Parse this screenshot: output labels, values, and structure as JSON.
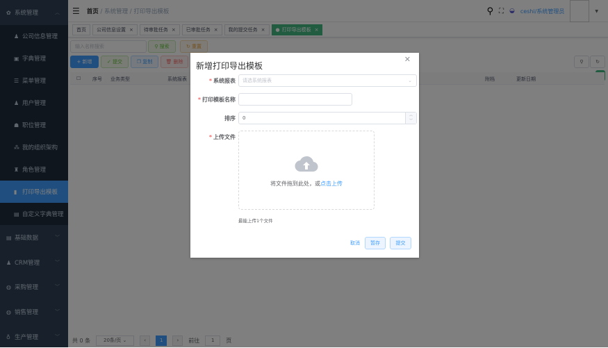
{
  "sidebar": {
    "items": [
      {
        "label": "系统管理",
        "icon": "gear-icon"
      },
      {
        "label": "公司信息管理",
        "icon": "user-icon"
      },
      {
        "label": "字典管理",
        "icon": "book-icon"
      },
      {
        "label": "菜单管理",
        "icon": "menu-icon"
      },
      {
        "label": "用户管理",
        "icon": "user-icon"
      },
      {
        "label": "职位管理",
        "icon": "briefcase-icon"
      },
      {
        "label": "我的组织架构",
        "icon": "tree-icon"
      },
      {
        "label": "角色管理",
        "icon": "role-icon"
      },
      {
        "label": "打印导出模板",
        "icon": "chart-icon"
      },
      {
        "label": "自定义字典管理",
        "icon": "dict-icon"
      },
      {
        "label": "基础数据",
        "icon": "database-icon"
      },
      {
        "label": "CRM管理",
        "icon": "user-icon"
      },
      {
        "label": "采购管理",
        "icon": "globe-icon"
      },
      {
        "label": "销售管理",
        "icon": "globe-icon"
      },
      {
        "label": "生产管理",
        "icon": "factory-icon"
      }
    ]
  },
  "header": {
    "breadcrumb": [
      "首页",
      "系统管理",
      "打印导出模板"
    ],
    "user": "ceshi/系统管理员"
  },
  "tags": [
    "首页",
    "公司信息设置",
    "待审批任务",
    "已审批任务",
    "我的提交任务",
    "打印导出模板"
  ],
  "search": {
    "placeholder": "输入名称搜索",
    "search": "搜索",
    "reset": "重置"
  },
  "toolbar": {
    "add": "新增",
    "submit": "提交",
    "copy": "复制",
    "delete": "删除"
  },
  "table": {
    "columns": [
      "序号",
      "业务类型",
      "系统报表",
      "附档",
      "更新日期"
    ]
  },
  "footer": {
    "total": "共 0 条",
    "page_size": "20条/页",
    "page": "1",
    "goto": "前往",
    "goto_value": "1",
    "page_unit": "页"
  },
  "modal": {
    "title": "新增打印导出模板",
    "fields": {
      "report_label": "系统报表",
      "report_placeholder": "请选系统报表",
      "name_label": "打印模板名称",
      "sort_label": "排序",
      "sort_value": "0",
      "file_label": "上传文件"
    },
    "upload_text": "将文件拖到此处，或",
    "upload_link": "点击上传",
    "upload_tip": "最能上传1个文件",
    "cancel": "取消",
    "save": "暂存",
    "submit": "提交"
  },
  "colors": {
    "accent": "#409eff",
    "tag_active": "#42b983",
    "sidebar": "#304156"
  }
}
